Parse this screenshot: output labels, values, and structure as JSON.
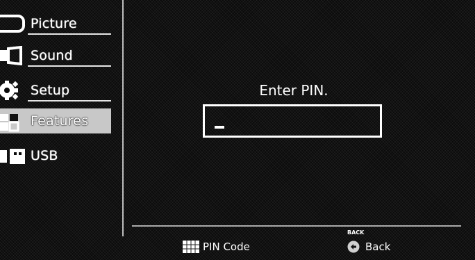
{
  "sidebar": {
    "items": [
      {
        "label": "Picture",
        "icon": "picture-icon"
      },
      {
        "label": "Sound",
        "icon": "speaker-icon"
      },
      {
        "label": "Setup",
        "icon": "gear-icon"
      },
      {
        "label": "Features",
        "icon": "features-icon",
        "selected": true
      },
      {
        "label": "USB",
        "icon": "usb-icon"
      }
    ]
  },
  "dialog": {
    "prompt": "Enter PIN.",
    "pin_value": "_"
  },
  "footer": {
    "pin_code_label": "PIN Code",
    "back_caption": "BACK",
    "back_label": "Back"
  }
}
